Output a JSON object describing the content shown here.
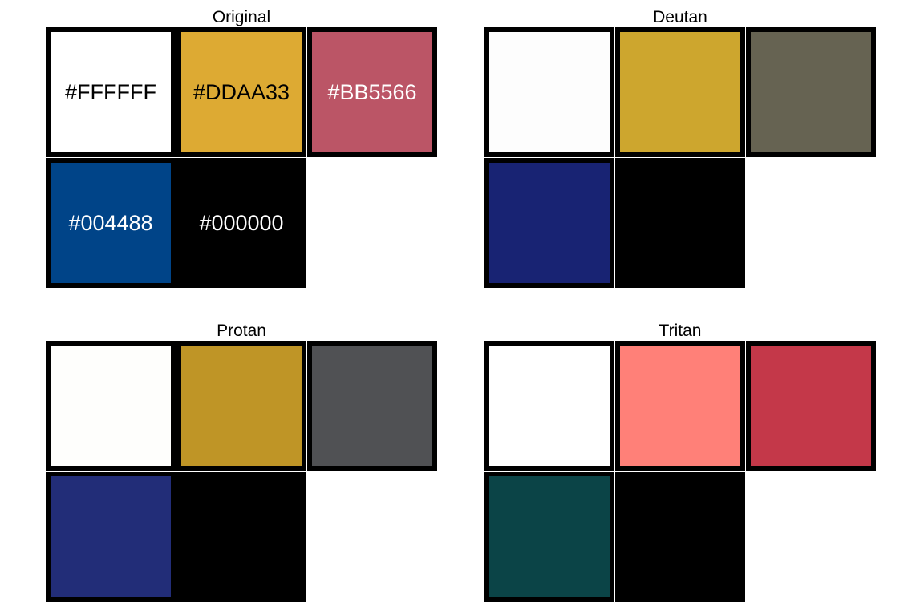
{
  "panels": [
    {
      "title": "Original",
      "swatches": [
        {
          "color": "#FFFFFF",
          "label": "#FFFFFF",
          "text_color": "#000000"
        },
        {
          "color": "#DDAA33",
          "label": "#DDAA33",
          "text_color": "#000000"
        },
        {
          "color": "#BB5566",
          "label": "#BB5566",
          "text_color": "#FFFFFF"
        },
        {
          "color": "#004488",
          "label": "#004488",
          "text_color": "#FFFFFF"
        },
        {
          "color": "#000000",
          "label": "#000000",
          "text_color": "#FFFFFF"
        }
      ]
    },
    {
      "title": "Deutan",
      "swatches": [
        {
          "color": "#FDFDFD"
        },
        {
          "color": "#CDA62E"
        },
        {
          "color": "#666352"
        },
        {
          "color": "#182373"
        },
        {
          "color": "#000000"
        }
      ]
    },
    {
      "title": "Protan",
      "swatches": [
        {
          "color": "#FEFEFC"
        },
        {
          "color": "#BF9526"
        },
        {
          "color": "#505154"
        },
        {
          "color": "#222D78"
        },
        {
          "color": "#000000"
        }
      ]
    },
    {
      "title": "Tritan",
      "swatches": [
        {
          "color": "#FFFFFF"
        },
        {
          "color": "#FF8078"
        },
        {
          "color": "#C43849"
        },
        {
          "color": "#0B4447"
        },
        {
          "color": "#000000"
        }
      ]
    }
  ]
}
